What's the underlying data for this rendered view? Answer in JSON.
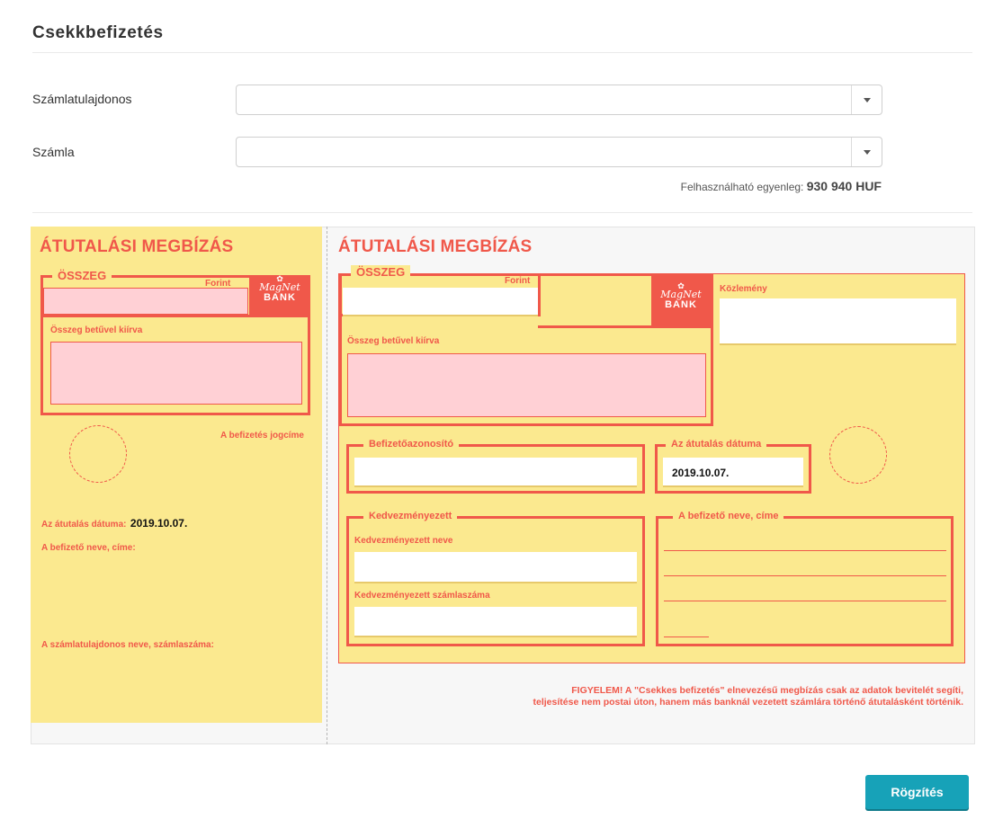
{
  "page": {
    "title": "Csekkbefizetés"
  },
  "form": {
    "owner_label": "Számlatulajdonos",
    "owner_value": "",
    "account_label": "Számla",
    "account_value": "",
    "balance_label": "Felhasználható egyenleg:",
    "balance_value": "930 940 HUF"
  },
  "stub": {
    "title": "ÁTUTALÁSI MEGBÍZÁS",
    "amount_legend": "ÖSSZEG",
    "currency": "Forint",
    "words_label": "Összeg betűvel kiírva",
    "purpose_label": "A befizetés jogcíme",
    "date_label": "Az átutalás dátuma:",
    "date_value": "2019.10.07.",
    "payer_label": "A befizető neve, címe:",
    "holder_label": "A számlatulajdonos neve, számlaszáma:"
  },
  "main": {
    "title": "ÁTUTALÁSI MEGBÍZÁS",
    "amount_legend": "ÖSSZEG",
    "currency": "Forint",
    "words_label": "Összeg betűvel kiírva",
    "note_label": "Közlemény",
    "payer_id_legend": "Befizetőazonosító",
    "date_legend": "Az átutalás dátuma",
    "date_value": "2019.10.07.",
    "beneficiary_legend": "Kedvezményezett",
    "beneficiary_name_label": "Kedvezményezett neve",
    "beneficiary_account_label": "Kedvezményezett számlaszáma",
    "payer_legend": "A befizető neve, címe"
  },
  "logo": {
    "name": "MagNet",
    "bank": "BANK"
  },
  "warning": {
    "line1": "FIGYELEM! A \"Csekkes befizetés\" elnevezésű megbízás csak az adatok bevitelét segíti,",
    "line2": "teljesítése nem postai úton, hanem más banknál vezetett számlára történő átutalásként történik."
  },
  "actions": {
    "save_label": "Rögzítés"
  },
  "colors": {
    "accent": "#f0584a",
    "cheque_bg": "#fbe98f",
    "pink_input": "#ffd0d5",
    "button": "#17a2b8"
  }
}
